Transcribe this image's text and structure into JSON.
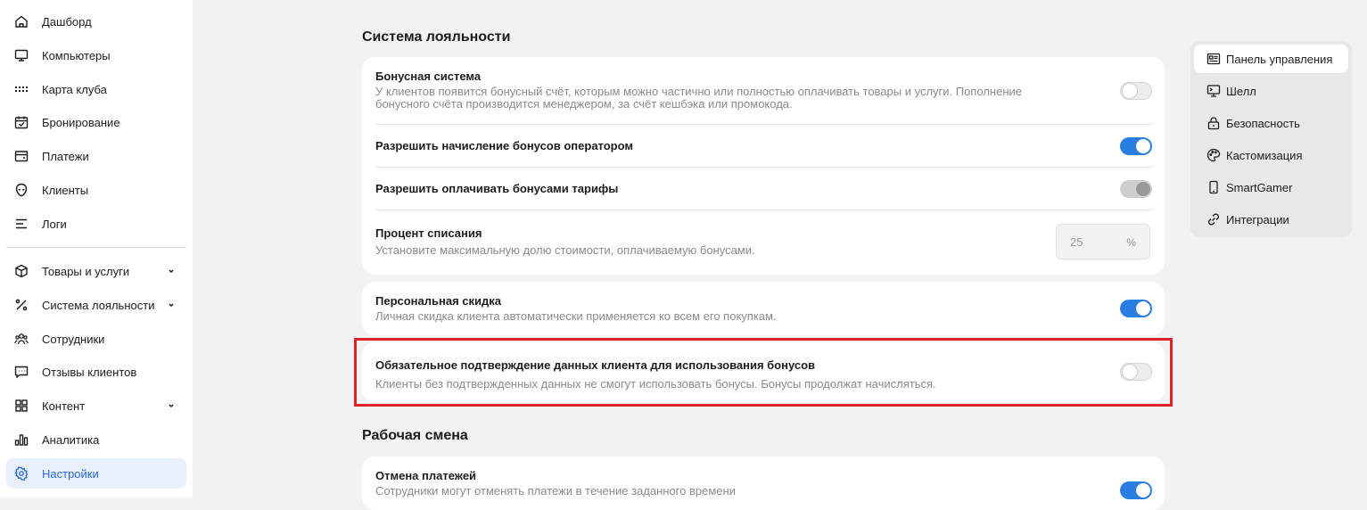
{
  "sidebar": {
    "items": [
      {
        "label": "Дашборд",
        "icon": "home-icon"
      },
      {
        "label": "Компьютеры",
        "icon": "monitor-icon"
      },
      {
        "label": "Карта клуба",
        "icon": "grid-dots-icon"
      },
      {
        "label": "Бронирование",
        "icon": "calendar-check-icon"
      },
      {
        "label": "Платежи",
        "icon": "wallet-icon"
      },
      {
        "label": "Клиенты",
        "icon": "alien-icon"
      },
      {
        "label": "Логи",
        "icon": "lines-icon"
      },
      {
        "label": "Товары и услуги",
        "icon": "box-icon",
        "expandable": true
      },
      {
        "label": "Система лояльности",
        "icon": "percent-icon",
        "expandable": true
      },
      {
        "label": "Сотрудники",
        "icon": "users-icon"
      },
      {
        "label": "Отзывы клиентов",
        "icon": "message-icon"
      },
      {
        "label": "Контент",
        "icon": "layout-grid-icon",
        "expandable": true
      },
      {
        "label": "Аналитика",
        "icon": "bar-chart-icon"
      },
      {
        "label": "Настройки",
        "icon": "settings-gear-icon",
        "active": true
      }
    ]
  },
  "loyalty": {
    "title": "Система лояльности",
    "bonus_system": {
      "title": "Бонусная система",
      "desc_line1": "У клиентов появится бонусный счёт, которым можно частично или полностью оплачивать товары и услуги. Пополнение",
      "desc_line2": "бонусного счёта производится менеджером, за счёт кешбэка или промокода.",
      "enabled": false
    },
    "allow_operator": {
      "title": "Разрешить начисление бонусов оператором",
      "enabled": true
    },
    "allow_tariffs": {
      "title": "Разрешить оплачивать бонусами тарифы",
      "enabled": true,
      "disabled": true
    },
    "write_off": {
      "title": "Процент списания",
      "desc": "Установите максимальную долю стоимости, оплачиваемую бонусами.",
      "value": "25",
      "unit": "%"
    },
    "personal_discount": {
      "title": "Персональная скидка",
      "desc": "Личная скидка клиента автоматически применяется ко всем его покупкам.",
      "enabled": true
    },
    "confirm_data": {
      "title": "Обязательное подтверждение данных клиента для использования бонусов",
      "desc": "Клиенты без подтвержденных данных не смогут использовать бонусы. Бонусы продолжат начисляться.",
      "enabled": false
    }
  },
  "shift": {
    "title": "Рабочая смена",
    "cancel_payments": {
      "title": "Отмена платежей",
      "desc": "Сотрудники могут отменять платежи в течение заданного времени",
      "enabled": true
    }
  },
  "right_nav": {
    "items": [
      {
        "label": "Панель управления",
        "icon": "dashboard-card-icon",
        "active": true
      },
      {
        "label": "Шелл",
        "icon": "monitor-shell-icon"
      },
      {
        "label": "Безопасность",
        "icon": "lock-icon"
      },
      {
        "label": "Кастомизация",
        "icon": "palette-icon"
      },
      {
        "label": "SmartGamer",
        "icon": "phone-icon"
      },
      {
        "label": "Интеграции",
        "icon": "link-icon"
      }
    ]
  },
  "colors": {
    "accent": "#2a7de1",
    "highlight_border": "#e0222a",
    "active_nav_bg": "#e8f0fb",
    "active_nav_text": "#2a6bd6"
  }
}
